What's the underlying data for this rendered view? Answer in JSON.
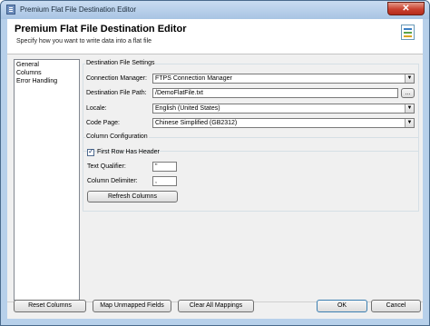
{
  "window": {
    "title": "Premium Flat File Destination Editor",
    "close_glyph": "✕"
  },
  "header": {
    "title": "Premium Flat File Destination Editor",
    "subtitle": "Specify how you want to write data into a flat file"
  },
  "nav": {
    "items": [
      {
        "label": "General"
      },
      {
        "label": "Columns"
      },
      {
        "label": "Error Handling"
      }
    ]
  },
  "destination": {
    "legend": "Destination File Settings",
    "connection_manager": {
      "label": "Connection Manager:",
      "value": "FTPS Connection Manager"
    },
    "file_path": {
      "label": "Destination File Path:",
      "value": "/DemoFlatFile.txt",
      "browse_label": "..."
    },
    "locale": {
      "label": "Locale:",
      "value": "English (United States)"
    },
    "code_page": {
      "label": "Code Page:",
      "value": "Chinese Simplified (GB2312)"
    }
  },
  "columns_config": {
    "legend": "Column Configuration",
    "first_row_header": {
      "label": "First Row Has Header",
      "checked": true
    },
    "text_qualifier": {
      "label": "Text Qualifier:",
      "value": "\""
    },
    "column_delimiter": {
      "label": "Column Delimiter:",
      "value": ","
    },
    "refresh_label": "Refresh Columns"
  },
  "footer": {
    "reset_label": "Reset Columns",
    "map_label": "Map Unmapped Fields",
    "clear_label": "Clear All Mappings",
    "ok_label": "OK",
    "cancel_label": "Cancel"
  },
  "colors": {
    "accent": "#b7d0ea",
    "close_red": "#c9412f"
  }
}
